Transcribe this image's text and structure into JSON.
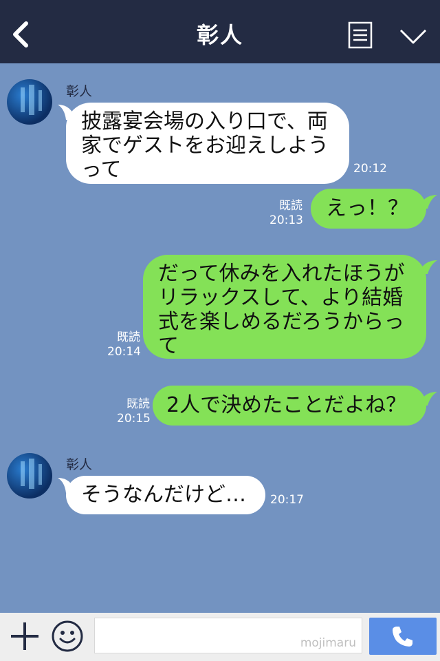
{
  "header": {
    "title": "彰人"
  },
  "messages": [
    {
      "sender": "彰人",
      "lines": [
        "披露宴会場の入り口で、両",
        "家でゲストをお迎えしよう",
        "って"
      ],
      "time": "20:12"
    },
    {
      "lines": [
        "えっ！？"
      ],
      "read": "既読",
      "time": "20:13"
    },
    {
      "lines": [
        "だって休みを入れたほうが",
        "リラックスして、より結婚",
        "式を楽しめるだろうからっ",
        "て"
      ],
      "read": "既読",
      "time": "20:14"
    },
    {
      "lines": [
        "2人で決めたことだよね？"
      ],
      "read": "既読",
      "time": "20:15"
    },
    {
      "sender": "彰人",
      "lines": [
        "そうなんだけど…"
      ],
      "time": "20:17"
    }
  ],
  "input": {
    "watermark": "mojimaru"
  },
  "colors": {
    "header": "#232b43",
    "chat_bg": "#7393c1",
    "green_bubble": "#84e157",
    "send": "#5a8ee6"
  }
}
